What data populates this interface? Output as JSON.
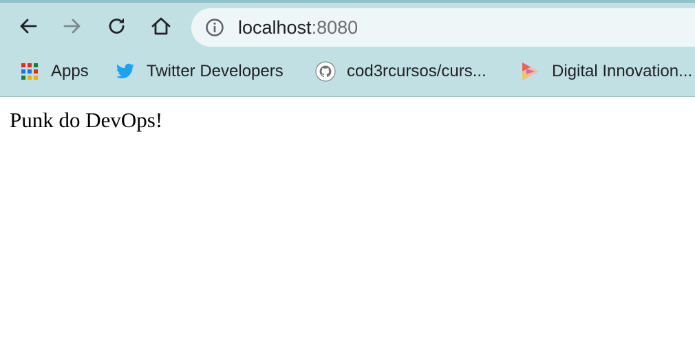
{
  "browser": {
    "address_bar": {
      "host": "localhost",
      "port": ":8080"
    },
    "bookmarks": [
      {
        "label": "Apps",
        "icon": "apps-grid-icon"
      },
      {
        "label": "Twitter Developers",
        "icon": "twitter-icon"
      },
      {
        "label": "cod3rcursos/curs...",
        "icon": "github-icon"
      },
      {
        "label": "Digital Innovation...",
        "icon": "dio-icon"
      }
    ],
    "colors": {
      "chrome_bg": "#c0e0e3",
      "omnibox_bg": "#eef6f7",
      "twitter_blue": "#1da1f2"
    }
  },
  "page": {
    "body_text": "Punk do DevOps!"
  }
}
